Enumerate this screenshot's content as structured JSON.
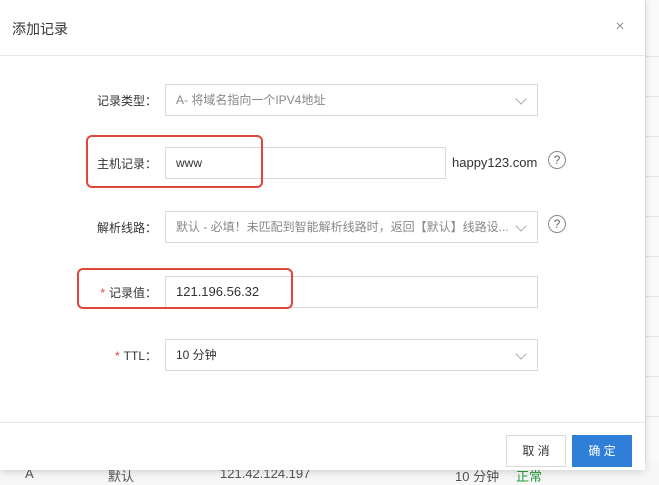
{
  "dialog": {
    "title": "添加记录",
    "close_icon": "×"
  },
  "form": {
    "record_type": {
      "label": "记录类型：",
      "value": "A- 将域名指向一个IPV4地址"
    },
    "host": {
      "label": "主机记录：",
      "value": "www",
      "suffix": "happy123.com",
      "help": "?"
    },
    "line": {
      "label": "解析线路：",
      "value": "默认 - 必填！未匹配到智能解析线路时，返回【默认】线路设...",
      "help": "?"
    },
    "record_value": {
      "required_mark": "*",
      "label": "记录值：",
      "value": "121.196.56.32"
    },
    "ttl": {
      "required_mark": "*",
      "label": "TTL：",
      "value": "10 分钟"
    }
  },
  "footer": {
    "cancel_label": "取 消",
    "ok_label": "确 定"
  },
  "background_row": {
    "type": "A",
    "line": "默认",
    "value": "121.42.124.197",
    "ttl": "10 分钟",
    "status": "正常"
  },
  "colors": {
    "primary": "#2f7fd9",
    "highlight": "#e0473b",
    "required": "#e5463f"
  }
}
